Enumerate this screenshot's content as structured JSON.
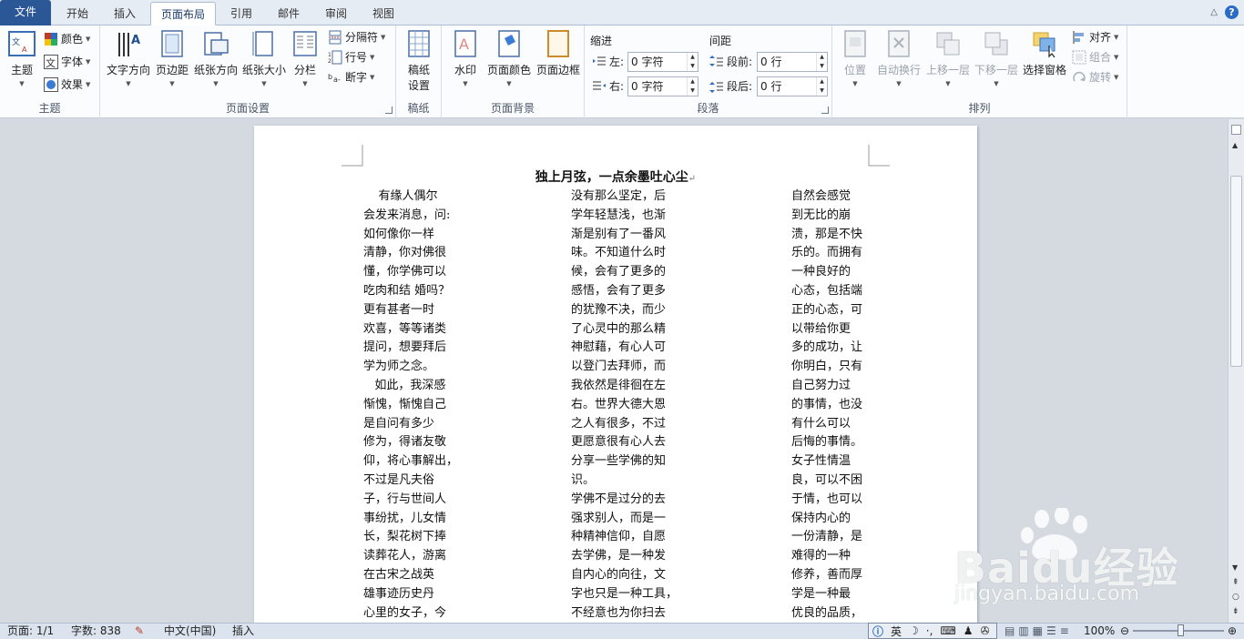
{
  "tabs": [
    {
      "label": "文件"
    },
    {
      "label": "开始"
    },
    {
      "label": "插入"
    },
    {
      "label": "页面布局"
    },
    {
      "label": "引用"
    },
    {
      "label": "邮件"
    },
    {
      "label": "审阅"
    },
    {
      "label": "视图"
    }
  ],
  "tab_right": {
    "collapse": "△",
    "help": "?"
  },
  "ribbon": {
    "theme": {
      "main": "主题",
      "colors": "颜色",
      "fonts": "字体",
      "effects": "效果",
      "group": "主题"
    },
    "page_setup": {
      "direction": "文字方向",
      "margins": "页边距",
      "orientation": "纸张方向",
      "size": "纸张大小",
      "columns": "分栏",
      "breaks": "分隔符",
      "line_numbers": "行号",
      "hyphenation": "断字",
      "group": "页面设置"
    },
    "manuscript": {
      "btn_line1": "稿纸",
      "btn_line2": "设置",
      "group": "稿纸"
    },
    "background": {
      "watermark": "水印",
      "page_color": "页面颜色",
      "page_border": "页面边框",
      "group": "页面背景"
    },
    "paragraph": {
      "indent_title": "缩进",
      "spacing_title": "间距",
      "left_label": "左:",
      "left_value": "0 字符",
      "right_label": "右:",
      "right_value": "0 字符",
      "before_label": "段前:",
      "before_value": "0 行",
      "after_label": "段后:",
      "after_value": "0 行",
      "group": "段落"
    },
    "arrange": {
      "position": "位置",
      "wrap": "自动换行",
      "forward": "上移一层",
      "backward": "下移一层",
      "selection_pane": "选择窗格",
      "align": "对齐",
      "group_btn": "组合",
      "rotate": "旋转",
      "group": "排列"
    }
  },
  "document": {
    "title": "独上月弦，一点余墨吐心尘",
    "columns": [
      [
        "    有缘人偶尔",
        "会发来消息，问:",
        "如何像你一样",
        "清静，你对佛很",
        "懂，你学佛可以",
        "吃肉和结 婚吗？",
        "更有甚者一时",
        "欢喜，等等诸类",
        "提问，想要拜后",
        "学为师之念。",
        "   如此，我深感",
        "惭愧，惭愧自己",
        "是自问有多少",
        "修为，得诸友敬",
        "仰，将心事解出，",
        "不过是凡夫俗",
        "子，行与世间人",
        "事纷扰，儿女情",
        "长，梨花树下捧",
        "读葬花人，游离",
        "在古宋之战英",
        "雄事迹历史丹",
        "心里的女子，今"
      ],
      [
        "没有那么坚定，后",
        "学年轻慧浅，也渐",
        "渐是别有了一番风",
        "味。不知道什么时",
        "候，会有了更多的",
        "感悟，会有了更多",
        "的犹豫不决，而少",
        "了心灵中的那么精",
        "神慰藉，有心人可",
        "以登门去拜师，而",
        "我依然是徘徊在左",
        "右。世界大德大恩",
        "之人有很多，不过",
        "更愿意很有心人去",
        "分享一些学佛的知",
        "识。",
        "学佛不是过分的去",
        "强求别人，而是一",
        "种精神信仰，自愿",
        "去学佛，是一种发",
        "自内心的向往，文",
        "字也只是一种工具，",
        "不经意也为你扫去"
      ],
      [
        "自然会感觉",
        "到无比的崩",
        "溃，那是不快",
        "乐的。而拥有",
        "一种良好的",
        "心态，包括端",
        "正的心态，可",
        "以带给你更",
        "多的成功，让",
        "你明白，只有",
        "自己努力过",
        "的事情，也没",
        "有什么可以",
        "后悔的事情。",
        "女子性情温",
        "良，可以不困",
        "于情，也可以",
        "保持内心的",
        "一份清静，是",
        "难得的一种",
        "修养，善而厚",
        "学是一种最",
        "优良的品质，"
      ]
    ],
    "return_mark": "↵"
  },
  "status": {
    "page": "页面: 1/1",
    "words": "字数: 838",
    "language": "中文(中国)",
    "mode": "插入",
    "zoom": "100%"
  },
  "ime": {
    "lang": "英"
  },
  "watermark": {
    "brand": "Baidu经验",
    "url": "jingyan.baidu.com"
  }
}
